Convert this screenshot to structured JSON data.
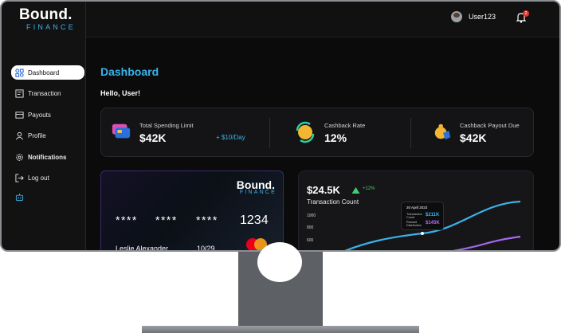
{
  "brand": {
    "name": "Bound.",
    "sub": "FINANCE"
  },
  "topbar": {
    "username": "User123",
    "notification_count": "2"
  },
  "sidebar": {
    "items": [
      {
        "label": "Dashboard",
        "icon": "dashboard-icon",
        "active": true
      },
      {
        "label": "Transaction",
        "icon": "transaction-icon"
      },
      {
        "label": "Payouts",
        "icon": "payouts-icon"
      },
      {
        "label": "Profile",
        "icon": "profile-icon"
      },
      {
        "label": "Notifications",
        "icon": "gear-icon"
      },
      {
        "label": "Log out",
        "icon": "logout-icon"
      }
    ]
  },
  "main": {
    "title": "Dashboard",
    "greeting": "Hello, User!",
    "stats": [
      {
        "label": "Total Spending Limit",
        "value": "$42K",
        "sub": "+ $10/Day",
        "icon": "card-icon"
      },
      {
        "label": "Cashback Rate",
        "value": "12%",
        "icon": "cashback-icon"
      },
      {
        "label": "Cashback Payout Due",
        "value": "$42K",
        "icon": "payout-bag-icon"
      }
    ],
    "card": {
      "brand": "Bound.",
      "brand_sub": "FINANCE",
      "masked": [
        "****",
        "****",
        "****"
      ],
      "last4": "1234",
      "holder": "Leslie Alexander",
      "expiry": "10/29"
    },
    "chart": {
      "amount": "$24.5K",
      "change": "+12%",
      "title": "Transaction Count",
      "yticks": [
        "1000",
        "800",
        "600"
      ],
      "tooltip": {
        "date": "20 April 2023",
        "rows": [
          {
            "label": "Transaction Count",
            "value": "$211K",
            "color": "#39b3ea"
          },
          {
            "label": "Reward Distribution",
            "value": "$145K",
            "color": "#b06cf0"
          }
        ]
      }
    }
  }
}
